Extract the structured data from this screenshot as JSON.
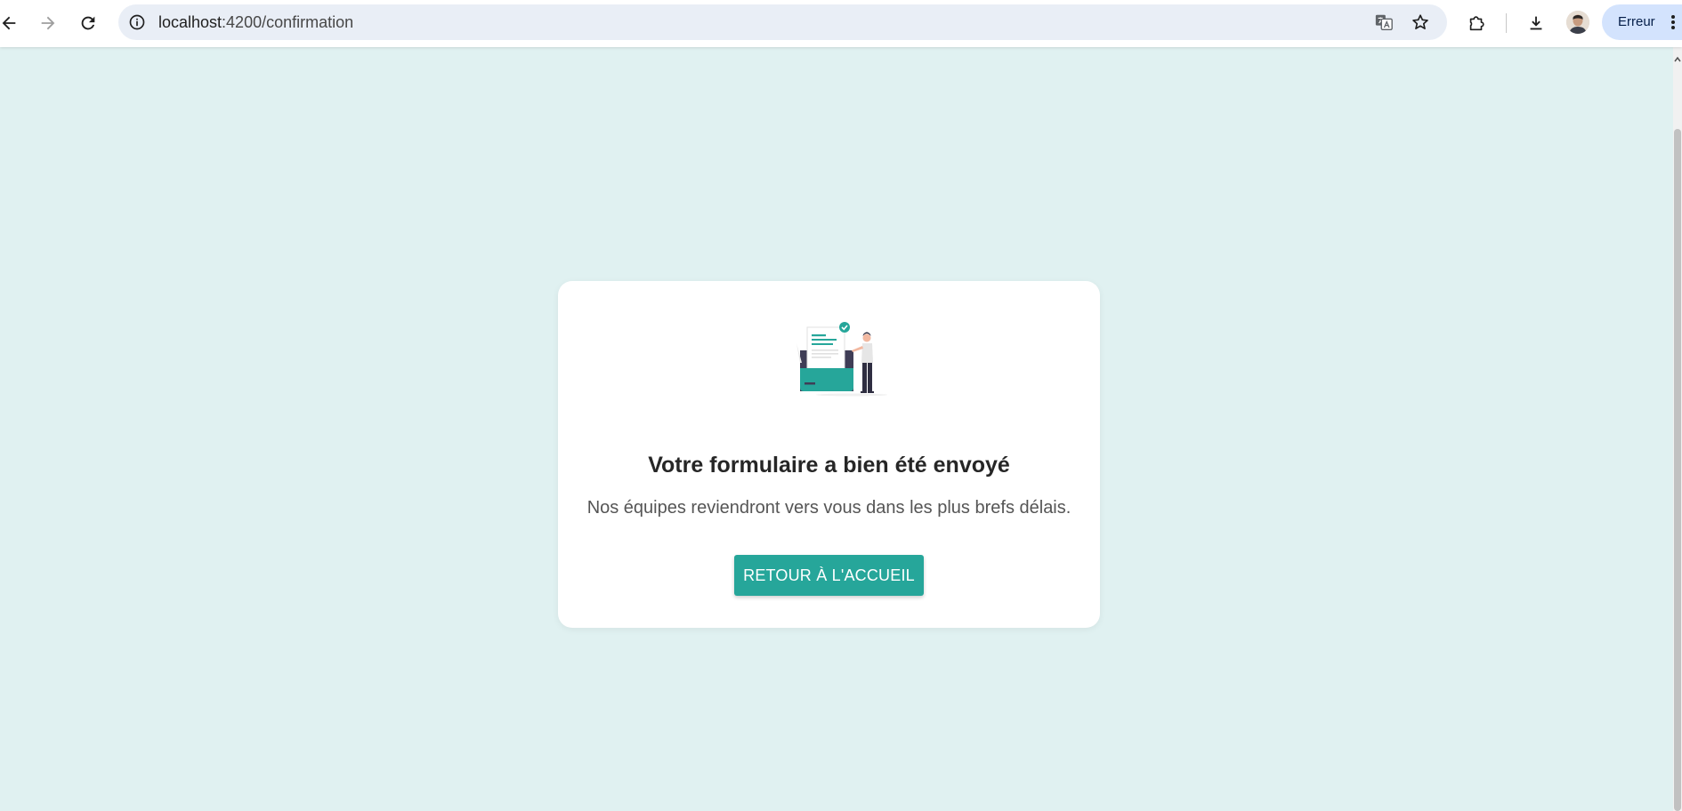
{
  "browser": {
    "url_host": "localhost",
    "url_path": ":4200/confirmation",
    "profile_error_label": "Erreur",
    "icons": {
      "back": "arrow-left-icon",
      "forward": "arrow-right-icon",
      "reload": "reload-icon",
      "site_info": "info-icon",
      "translate": "translate-icon",
      "bookmark": "star-icon",
      "extensions": "puzzle-icon",
      "downloads": "download-icon",
      "menu": "kebab-menu-icon"
    }
  },
  "confirmation": {
    "title": "Votre formulaire a bien été envoyé",
    "subtitle": "Nos équipes reviendront vers vous dans les plus brefs délais.",
    "button_label": "RETOUR À L'ACCUEIL"
  },
  "colors": {
    "page_background": "#e0f1f1",
    "card_background": "#ffffff",
    "accent": "#26a69a",
    "title_text": "#262626",
    "subtitle_text": "#555555"
  }
}
